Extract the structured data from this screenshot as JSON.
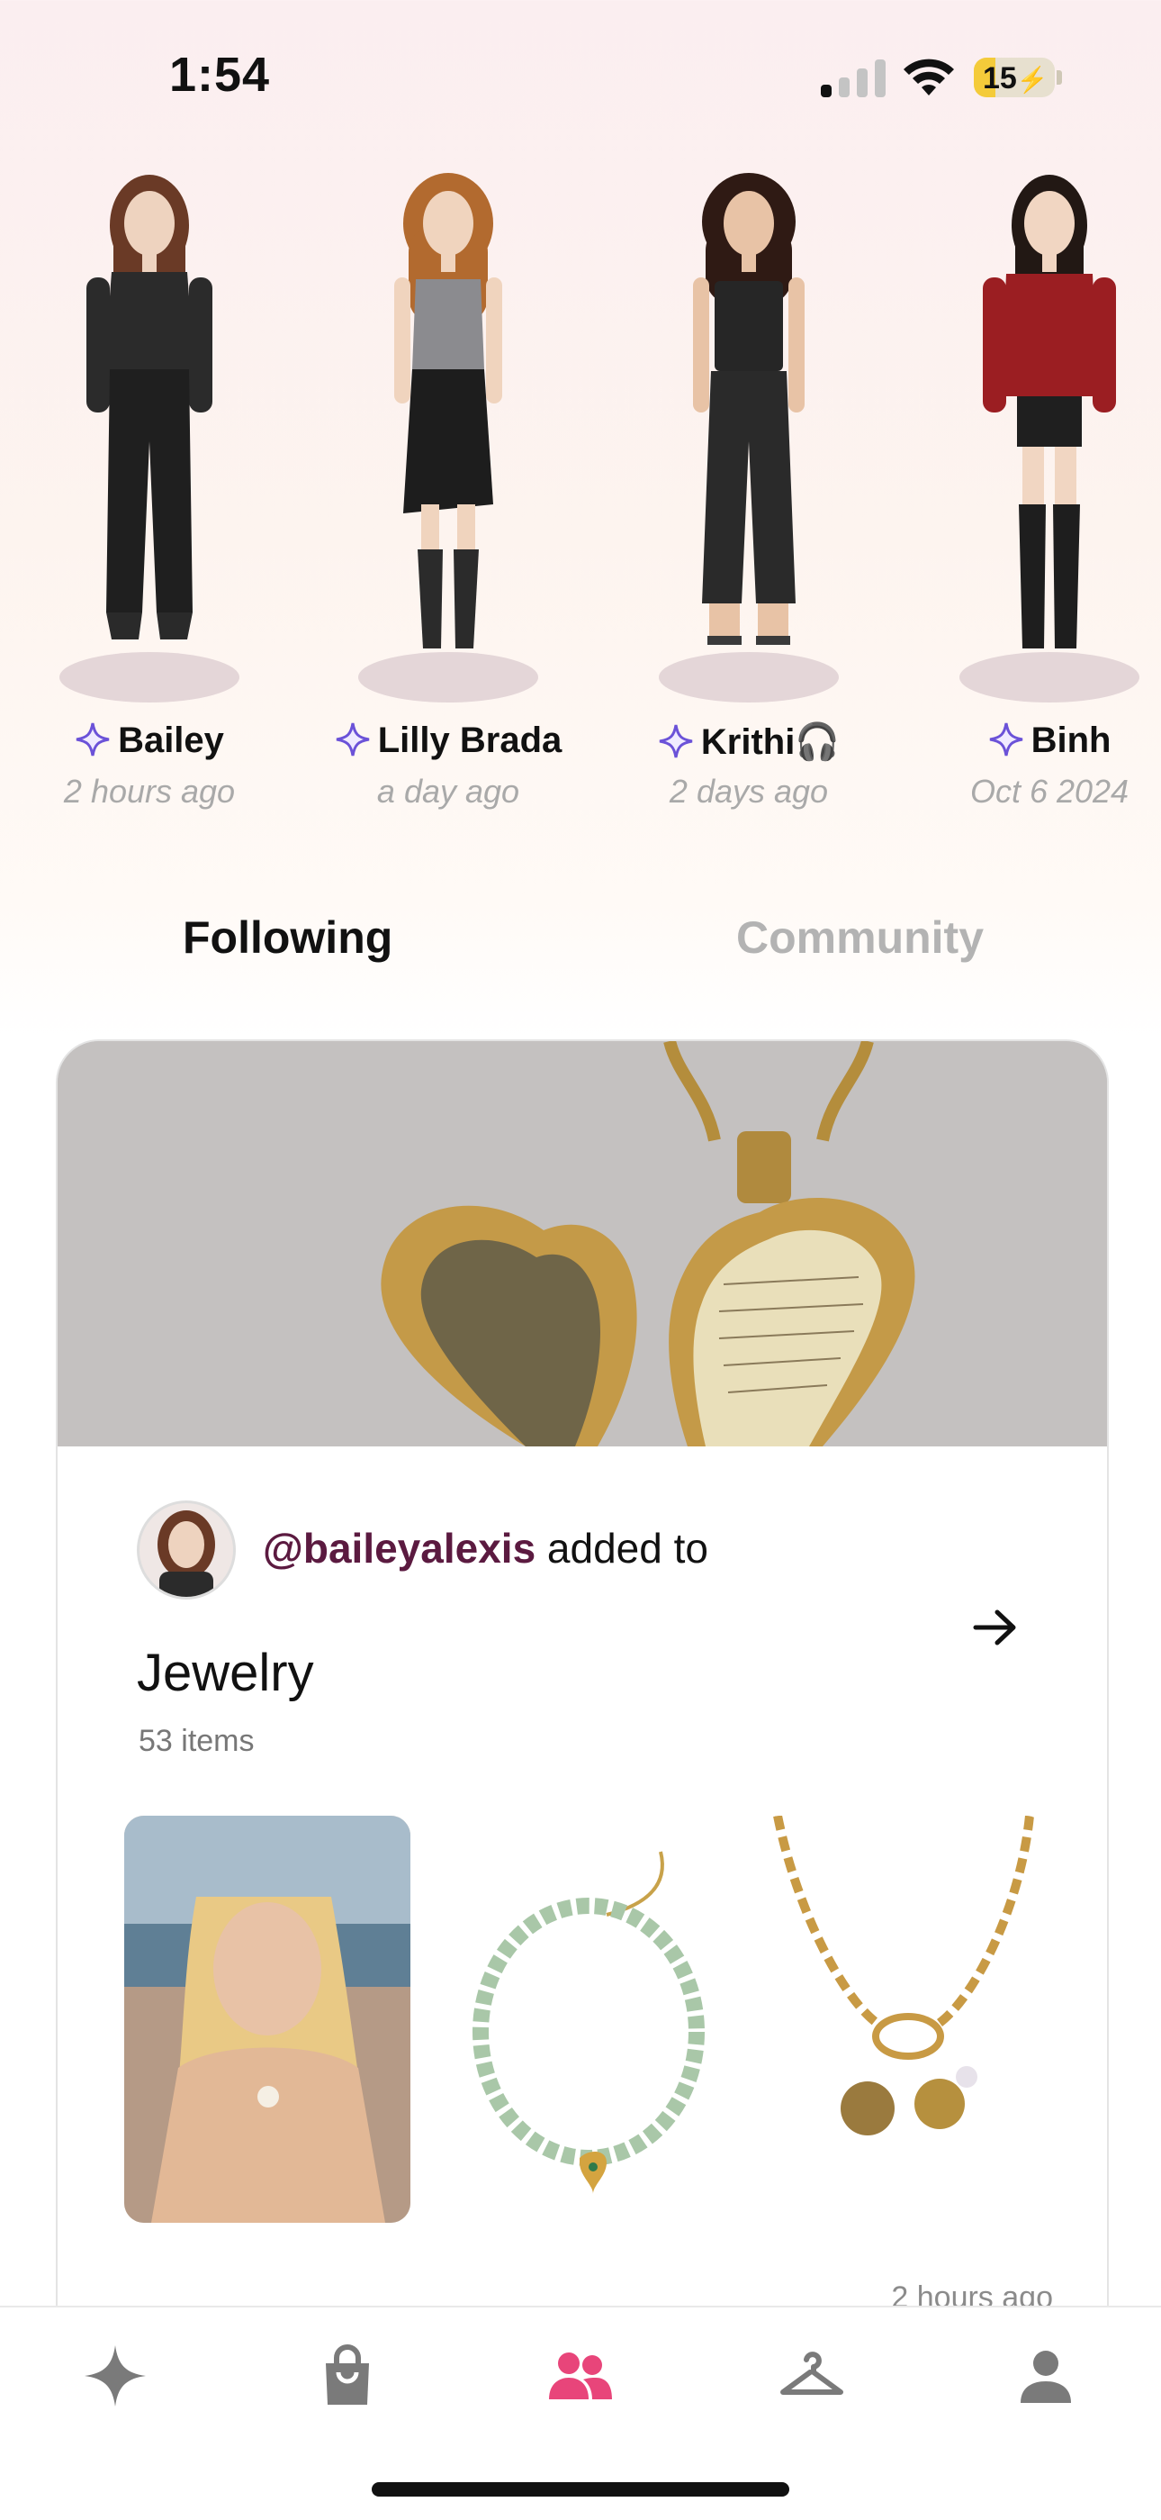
{
  "status_bar": {
    "time": "1:54",
    "battery": "15"
  },
  "stories": [
    {
      "name": "Bailey",
      "time": "2 hours ago",
      "hair": "#6a3a26",
      "top": "#2b2b2b",
      "bottom": "#1f1f1f",
      "shoes": "#2a2a2a",
      "skin": "#eed3bf"
    },
    {
      "name": "Lilly Brada",
      "time": "a day ago",
      "hair": "#b26a2f",
      "top": "#8b8b8f",
      "bottom": "#1d1d1d",
      "shoes": "#2b2b2b",
      "skin": "#f0d4be"
    },
    {
      "name": "Krithi🎧",
      "time": "2 days ago",
      "hair": "#2f1a14",
      "top": "#262626",
      "bottom": "#2a2a2a",
      "shoes": "#3a3a3a",
      "skin": "#e8c3a6"
    },
    {
      "name": "Binh",
      "time": "Oct 6 2024",
      "hair": "#221814",
      "top": "#9b1e22",
      "bottom": "#1f1f1f",
      "shoes": "#1e1e1e",
      "skin": "#f1d6c2"
    }
  ],
  "tabs": {
    "following": "Following",
    "community": "Community"
  },
  "feed_card": {
    "username": "@baileyalexis",
    "action": " added to",
    "collection": "Jewelry",
    "count": "53 items",
    "time": "2 hours ago"
  },
  "nav": {
    "items": [
      "sparkle-icon",
      "shopping-bag-icon",
      "people-icon",
      "hanger-icon",
      "person-icon"
    ],
    "active_color": "#e8457a",
    "inactive_color": "#7a7a7a"
  },
  "colors": {
    "accent": "#5b1a40",
    "spark": "#6b52d8"
  }
}
